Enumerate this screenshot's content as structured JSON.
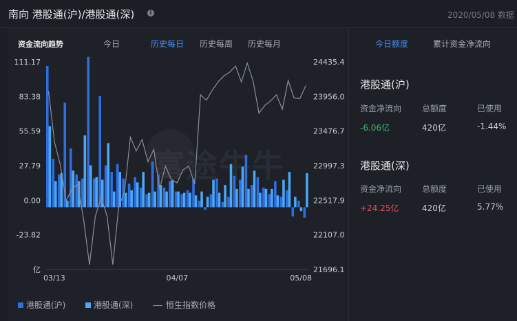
{
  "header": {
    "title": "南向 港股通(沪)/港股通(深)",
    "date": "2020/05/08 数据"
  },
  "left": {
    "section_label": "资金流向趋势",
    "tabs": [
      {
        "label": "今日",
        "active": false
      },
      {
        "label": "历史每日",
        "active": true
      },
      {
        "label": "历史每周",
        "active": false
      },
      {
        "label": "历史每月",
        "active": false
      }
    ],
    "legend": [
      {
        "label": "港股通(沪)",
        "color": "#2e6fe0"
      },
      {
        "label": "港股通(深)",
        "color": "#4aa8f5"
      },
      {
        "label": "恒生指数价格",
        "color": "#8a8f98"
      }
    ]
  },
  "right": {
    "tabs": [
      {
        "label": "今日额度",
        "active": true
      },
      {
        "label": "累计资金净流向",
        "active": false
      }
    ],
    "sections": [
      {
        "title": "港股通(沪)",
        "cols": [
          "资金净流向",
          "总额度",
          "已使用"
        ],
        "values": [
          "-6.06亿",
          "420亿",
          "-1.44%"
        ],
        "sign": "neg"
      },
      {
        "title": "港股通(深)",
        "cols": [
          "资金净流向",
          "总额度",
          "已使用"
        ],
        "values": [
          "+24.25亿",
          "420亿",
          "5.77%"
        ],
        "sign": "pos"
      }
    ]
  },
  "chart_data": {
    "type": "bar",
    "left_axis_ticks": [
      "111.17",
      "83.38",
      "55.59",
      "27.79",
      "0.00",
      "-23.82",
      "亿"
    ],
    "right_axis_ticks": [
      "24435.4",
      "23956.0",
      "23476.7",
      "22997.3",
      "22517.9",
      "22107.0",
      "21696.1"
    ],
    "x_ticks": [
      "03/13",
      "04/07",
      "05/08"
    ],
    "ylim": [
      -47.6,
      111.17
    ],
    "y2lim": [
      21696.1,
      24435.4
    ],
    "series": [
      {
        "name": "港股通(沪)",
        "color": "#2e6fe0",
        "values": [
          108,
          37,
          25,
          80,
          45,
          25,
          22,
          115,
          22,
          85,
          32,
          27,
          33,
          22,
          18,
          23,
          15,
          10,
          35,
          25,
          15,
          20,
          12,
          10,
          13,
          22,
          5,
          -2,
          10,
          22,
          4,
          8,
          24,
          21,
          40,
          17,
          23,
          15,
          10,
          20,
          8,
          13,
          -7,
          5,
          -8
        ]
      },
      {
        "name": "港股通(深)",
        "color": "#4aa8f5",
        "values": [
          62,
          20,
          26,
          5,
          28,
          20,
          55,
          32,
          23,
          21,
          49,
          12,
          27,
          11,
          13,
          19,
          27,
          11,
          12,
          17,
          12,
          21,
          12,
          11,
          11,
          9,
          12,
          8,
          21,
          11,
          17,
          33,
          14,
          31,
          14,
          28,
          11,
          14,
          14,
          9,
          21,
          27,
          8,
          -3,
          26
        ]
      },
      {
        "name": "恒生指数价格",
        "color": "#8a8f98",
        "values": [
          24050,
          23380,
          23080,
          22600,
          22760,
          22820,
          22350,
          21760,
          22400,
          22650,
          22400,
          21760,
          22520,
          22720,
          23440,
          23260,
          23410,
          23120,
          23280,
          22760,
          23060,
          22880,
          22840,
          23010,
          23060,
          22820,
          24000,
          23930,
          24060,
          24170,
          24250,
          24300,
          24380,
          24170,
          24420,
          24180,
          23760,
          23860,
          23920,
          24000,
          23810,
          24190,
          23960,
          23950,
          24120
        ]
      }
    ]
  }
}
